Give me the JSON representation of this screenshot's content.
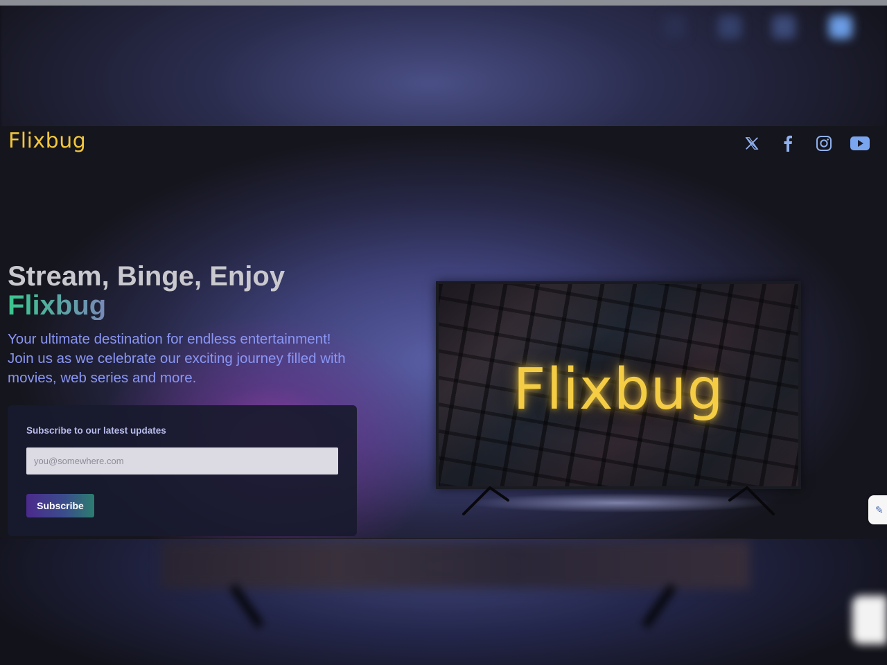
{
  "brand": {
    "logo": "Flixbug",
    "color": "#f3c73d"
  },
  "social": [
    {
      "name": "x-twitter-icon",
      "label": "X"
    },
    {
      "name": "facebook-icon",
      "label": "Facebook"
    },
    {
      "name": "instagram-icon",
      "label": "Instagram"
    },
    {
      "name": "youtube-icon",
      "label": "YouTube"
    }
  ],
  "hero": {
    "title_line1": "Stream, Binge, Enjoy",
    "title_line2": "Flixbug",
    "description": "Your ultimate destination for endless entertainment! Join us as we celebrate our exciting journey filled with movies, web series and more."
  },
  "subscribe": {
    "title": "Subscribe to our latest updates",
    "email_placeholder": "you@somewhere.com",
    "email_value": "",
    "button_label": "Subscribe"
  },
  "tv": {
    "screen_logo": "Flixbug"
  },
  "colors": {
    "accent_text": "#8a96f5",
    "button_gradient_start": "#4b2a8c",
    "button_gradient_end": "#2c7d6e",
    "youtube_icon": "#7aa6f0"
  }
}
